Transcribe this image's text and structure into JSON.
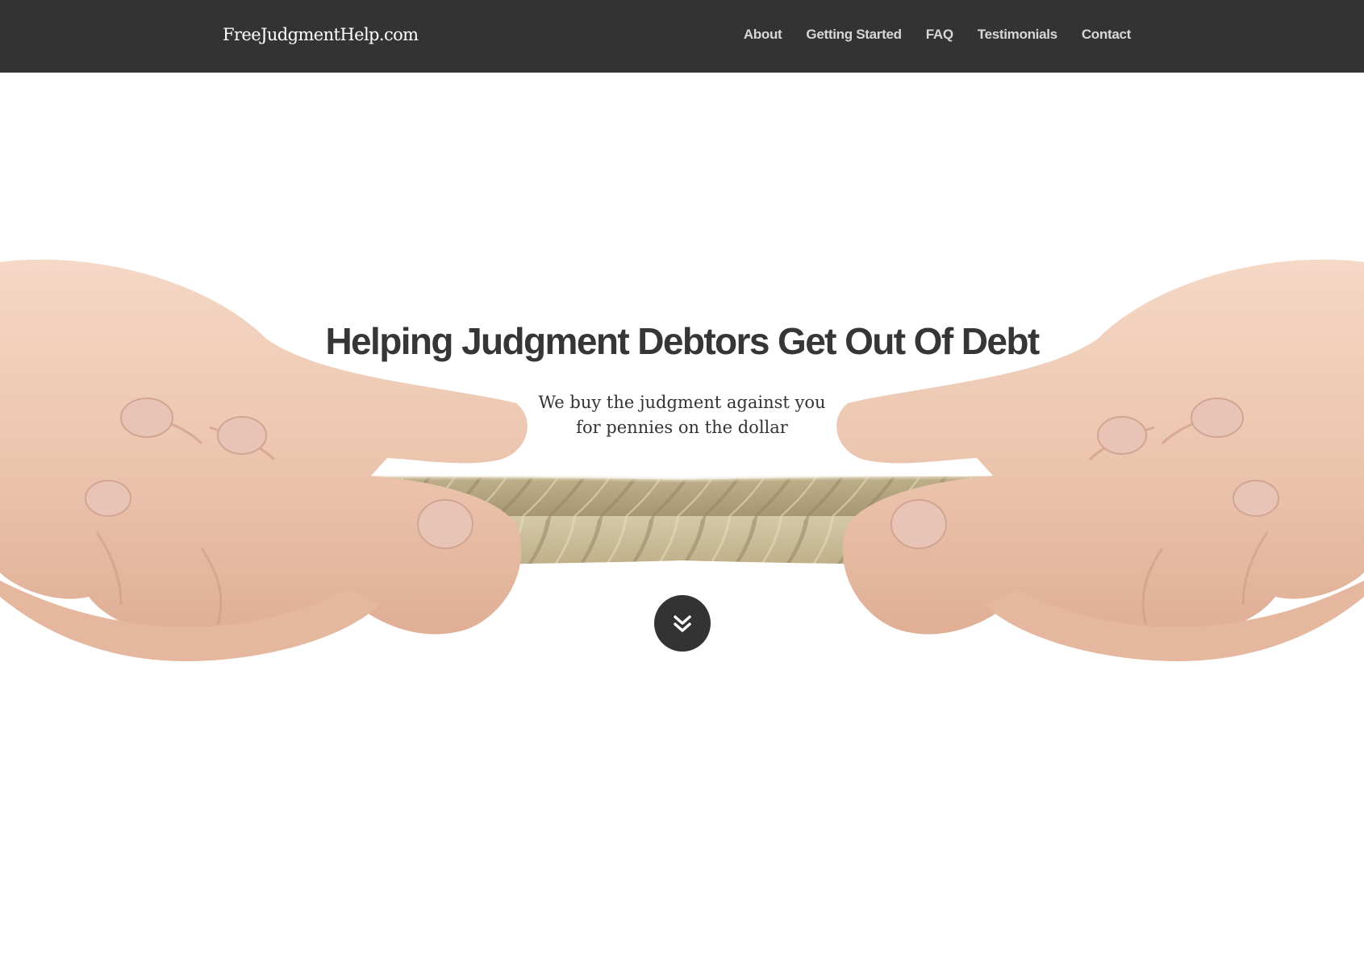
{
  "header": {
    "brand": "FreeJudgmentHelp.com",
    "nav": [
      {
        "label": "About"
      },
      {
        "label": "Getting Started"
      },
      {
        "label": "FAQ"
      },
      {
        "label": "Testimonials"
      },
      {
        "label": "Contact"
      }
    ]
  },
  "hero": {
    "title": "Helping Judgment Debtors Get Out Of Debt",
    "subtitle_line1": "We buy the judgment against you",
    "subtitle_line2": "for pennies on the dollar",
    "scroll_icon": "double-chevron-down-icon",
    "image": "hands-pulling-rope"
  },
  "colors": {
    "navbar_bg": "#333333",
    "nav_text": "#d7d7d7",
    "title_text": "#363636",
    "button_bg": "#333333"
  }
}
